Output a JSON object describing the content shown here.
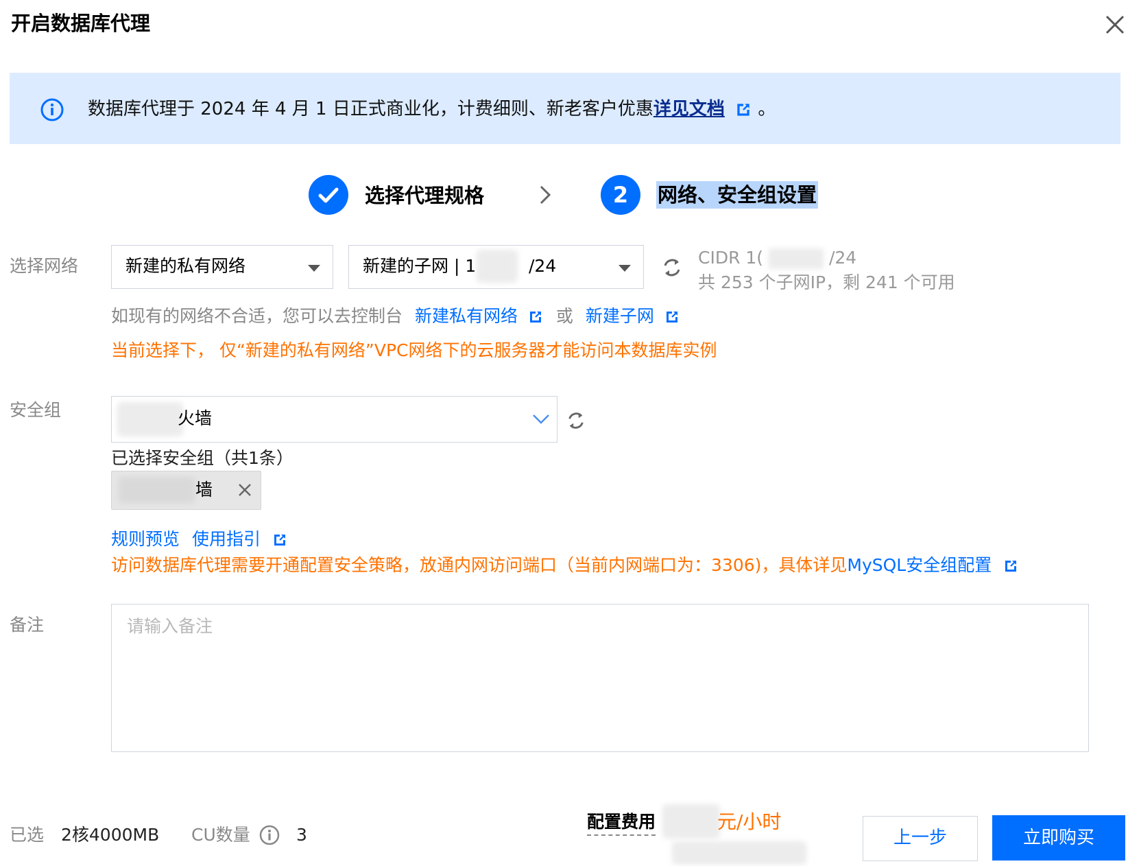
{
  "dialog": {
    "title": "开启数据库代理"
  },
  "notice": {
    "text": "数据库代理于 2024 年 4 月 1 日正式商业化，计费细则、新老客户优惠",
    "link": "详见文档",
    "suffix": "。"
  },
  "steps": [
    {
      "label": "选择代理规格",
      "status": "done"
    },
    {
      "number": "2",
      "label": "网络、安全组设置",
      "status": "current"
    }
  ],
  "network": {
    "label": "选择网络",
    "vpc_value": "新建的私有网络",
    "subnet_prefix": "新建的子网 | 1",
    "subnet_suffix": "/24",
    "cidr_prefix": "CIDR 1(",
    "cidr_suffix": "/24",
    "subnet_count": "共 253 个子网IP，剩 241 个可用",
    "hint_prefix": "如现有的网络不合适，您可以去控制台",
    "create_vpc_link": "新建私有网络",
    "or_text": "或",
    "create_subnet_link": "新建子网",
    "warning": "当前选择下， 仅“新建的私有网络”VPC网络下的云服务器才能访问本数据库实例"
  },
  "security_group": {
    "label": "安全组",
    "value_suffix": "火墙",
    "selected_count": "已选择安全组（共1条）",
    "tag_suffix": "墙",
    "rules_preview": "规则预览",
    "usage_guide": "使用指引",
    "warning": "访问数据库代理需要开通配置安全策略，放通内网访问端口（当前内网端口为：3306)，具体详见",
    "mysql_link": "MySQL安全组配置"
  },
  "remark": {
    "label": "备注",
    "placeholder": "请输入备注"
  },
  "footer": {
    "selected_label": "已选",
    "selected_value": "2核4000MB",
    "cu_label": "CU数量",
    "cu_value": "3",
    "fee_label": "配置费用",
    "fee_unit": "元/小时",
    "prev_button": "上一步",
    "buy_button": "立即购买"
  },
  "colors": {
    "primary": "#006eff",
    "warning": "#ff7200",
    "notice_bg": "#dcebff"
  }
}
